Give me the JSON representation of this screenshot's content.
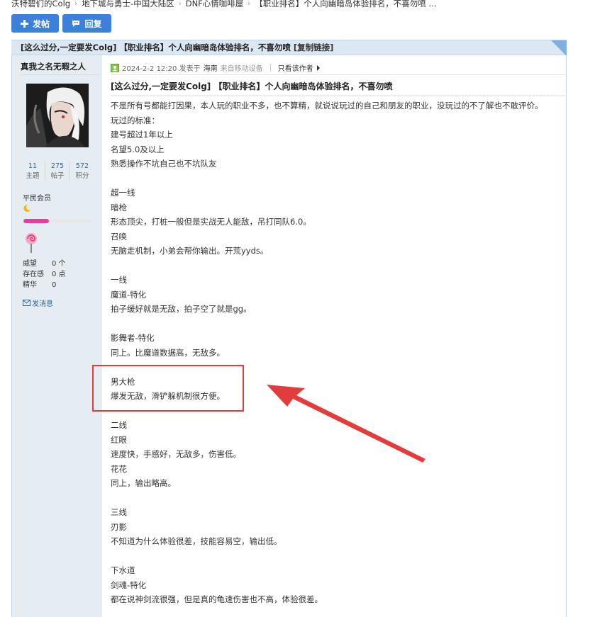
{
  "breadcrumb": [
    "沃特碧们的Colg",
    "地下城与勇士-中国大陆区",
    "DNF心情咖啡屋",
    "【职业排名】个人向幽暗岛体验排名，不喜勿喷 ..."
  ],
  "toolbar": {
    "post_label": "发帖",
    "reply_label": "回复"
  },
  "thread": {
    "title_bar": "[这么过分,一定要发Colg] 【职业排名】个人向幽暗岛体验排名，不喜勿喷",
    "copy_link": "[复制链接]"
  },
  "author": {
    "name": "真我之名无暇之人",
    "stats": [
      {
        "num": "11",
        "label": "主题"
      },
      {
        "num": "275",
        "label": "帖子"
      },
      {
        "num": "572",
        "label": "积分"
      }
    ],
    "group": "平民会员",
    "level_fraction": 0.38,
    "props": [
      {
        "k": "威望",
        "v": "0 个"
      },
      {
        "k": "存在感",
        "v": "0 点"
      },
      {
        "k": "精华",
        "v": "0"
      }
    ],
    "send_msg": "发消息"
  },
  "post": {
    "date": "2024-2-2 12:20 发表于",
    "location": "海南",
    "device": "来自移动设备",
    "only_author": "只看该作者",
    "title": "[这么过分,一定要发Colg] 【职业排名】个人向幽暗岛体验排名，不喜勿喷",
    "lines": [
      "不是所有号都能打因果，本人玩的职业不多，也不算精，就说说玩过的自己和朋友的职业，没玩过的不了解也不敢评价。",
      "玩过的标准：",
      "建号超过1年以上",
      "名望5.0及以上",
      "熟悉操作不坑自己也不坑队友",
      "",
      "超一线",
      "暗枪",
      "形态顶尖，打桩一般但是实战无人能敌，吊打同队6.0。",
      "召唤",
      "无脑走机制，小弟会帮你输出。开荒yyds。",
      "",
      "一线",
      "魔道-特化",
      "拍子缓好就是无敌，拍子空了就是gg。",
      "",
      "影舞者-特化",
      "同上。比魔道数据高，无敌多。",
      "",
      "男大枪",
      "爆发无敌，滑铲躲机制很方便。",
      "",
      "二线",
      "红眼",
      "速度快，手感好，无敌多，伤害低。",
      "花花",
      "同上，输出略高。",
      "",
      "三线",
      "刃影",
      "不知道为什么体验很差，技能容易空，输出低。",
      "",
      "下水道",
      "剑魂-特化",
      "都在说神剑流很强，但是真的龟速伤害也不高，体验很差。"
    ]
  },
  "colors": {
    "accent": "#3d7fd9",
    "annotation": "#e23c3c",
    "sidebar": "#e5edf2"
  }
}
